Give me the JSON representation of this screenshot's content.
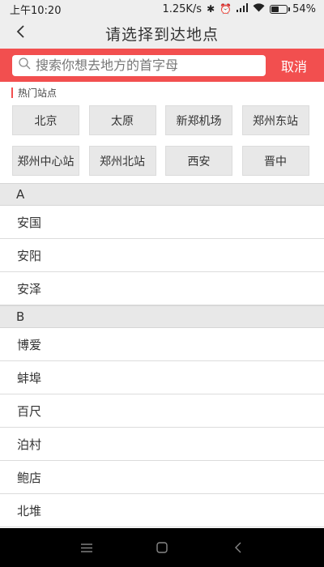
{
  "status_bar": {
    "time": "上午10:20",
    "speed": "1.25K/s",
    "battery_percent": "54%"
  },
  "header": {
    "title": "请选择到达地点"
  },
  "search": {
    "placeholder": "搜索你想去地方的首字母",
    "cancel_label": "取消"
  },
  "hot": {
    "title": "热门站点",
    "stations": [
      "北京",
      "太原",
      "新郑机场",
      "郑州东站",
      "郑州中心站",
      "郑州北站",
      "西安",
      "晋中"
    ]
  },
  "sections": [
    {
      "letter": "A",
      "cities": [
        "安国",
        "安阳",
        "安泽"
      ]
    },
    {
      "letter": "B",
      "cities": [
        "博爱",
        "蚌埠",
        "百尺",
        "泊村",
        "鲍店",
        "北堆"
      ]
    }
  ],
  "colors": {
    "accent": "#f24f4f",
    "nav_bg": "#eeeeee",
    "section_bg": "#e8e8e8"
  },
  "icons": {
    "back": "chevron-left-icon",
    "search": "search-icon",
    "menu": "menu-icon",
    "home": "home-icon",
    "system_back": "back-icon"
  }
}
